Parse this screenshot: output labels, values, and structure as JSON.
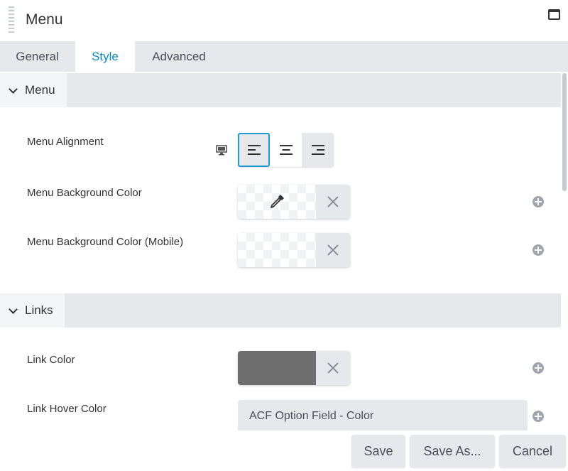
{
  "header": {
    "title": "Menu"
  },
  "tabs": [
    {
      "label": "General"
    },
    {
      "label": "Style"
    },
    {
      "label": "Advanced"
    }
  ],
  "active_tab": "Style",
  "sections": {
    "menu": {
      "title": "Menu",
      "rows": {
        "alignment": {
          "label": "Menu Alignment",
          "selected": "left"
        },
        "background_color": {
          "label": "Menu Background Color",
          "value": ""
        },
        "background_color_mobile": {
          "label": "Menu Background Color (Mobile)",
          "value": ""
        }
      }
    },
    "links": {
      "title": "Links",
      "rows": {
        "link_color": {
          "label": "Link Color",
          "value": "#6e6e6e"
        },
        "link_hover_color": {
          "label": "Link Hover Color",
          "field_value": "ACF Option Field - Color"
        }
      }
    }
  },
  "footer": {
    "save_label": "Save",
    "save_as_label": "Save As...",
    "cancel_label": "Cancel"
  },
  "colors": {
    "accent": "#0e86b5",
    "selected_border": "#1e9bd7",
    "panel_gray": "#e6e8ec",
    "link_swatch": "#6e6e6e"
  }
}
